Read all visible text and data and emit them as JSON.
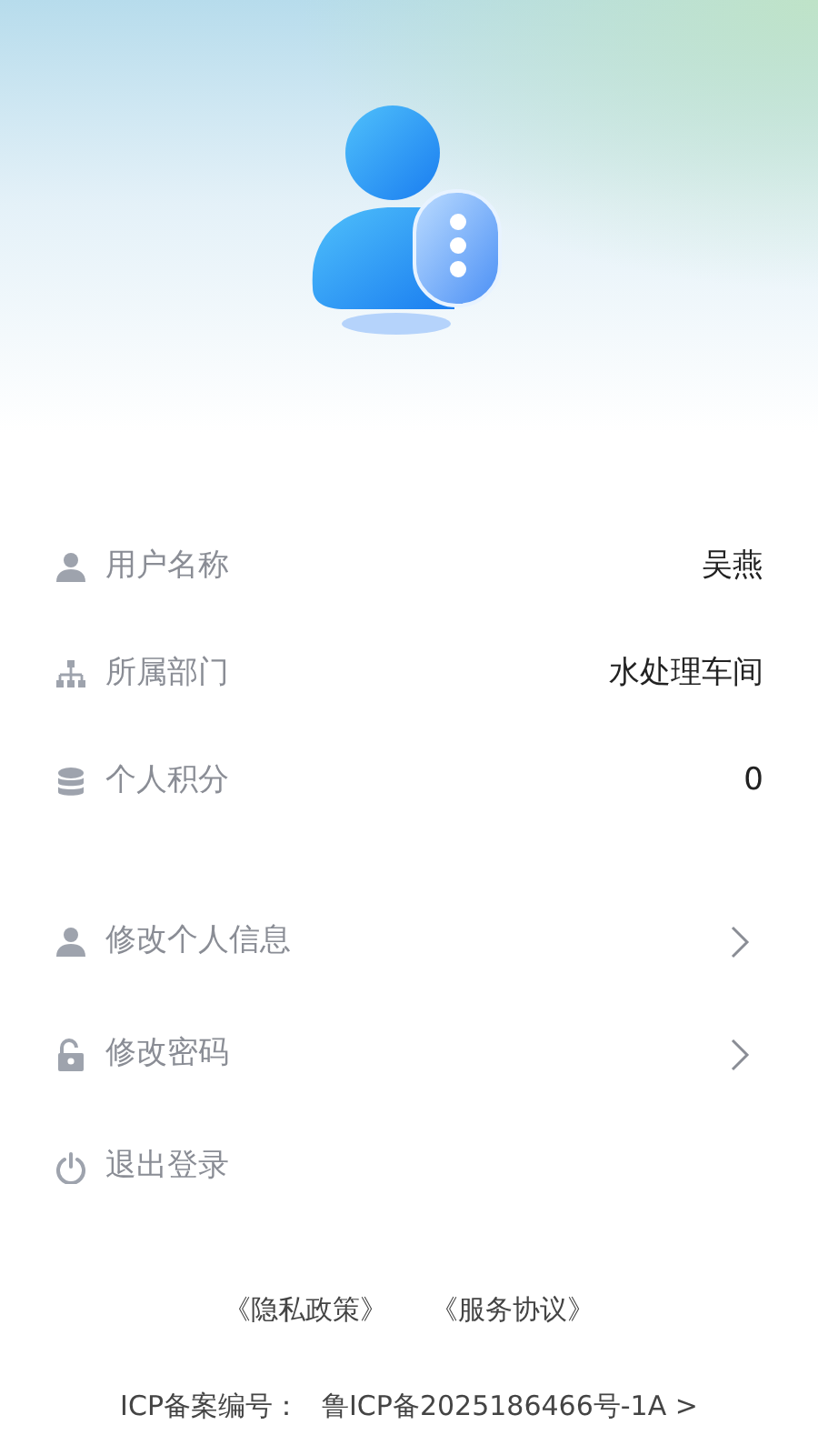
{
  "profile": [
    {
      "label": "用户名称",
      "value": "吴燕"
    },
    {
      "label": "所属部门",
      "value": "水处理车间"
    },
    {
      "label": "个人积分",
      "value": "0"
    }
  ],
  "actions": [
    {
      "label": "修改个人信息",
      "arrow": true
    },
    {
      "label": "修改密码",
      "arrow": true
    },
    {
      "label": "退出登录",
      "arrow": false
    }
  ],
  "footer": {
    "links": [
      "《隐私政策》",
      "《服务协议》"
    ],
    "icp_label": "ICP备案编号：",
    "icp_number": "鲁ICP备2025186466号-1A >"
  }
}
